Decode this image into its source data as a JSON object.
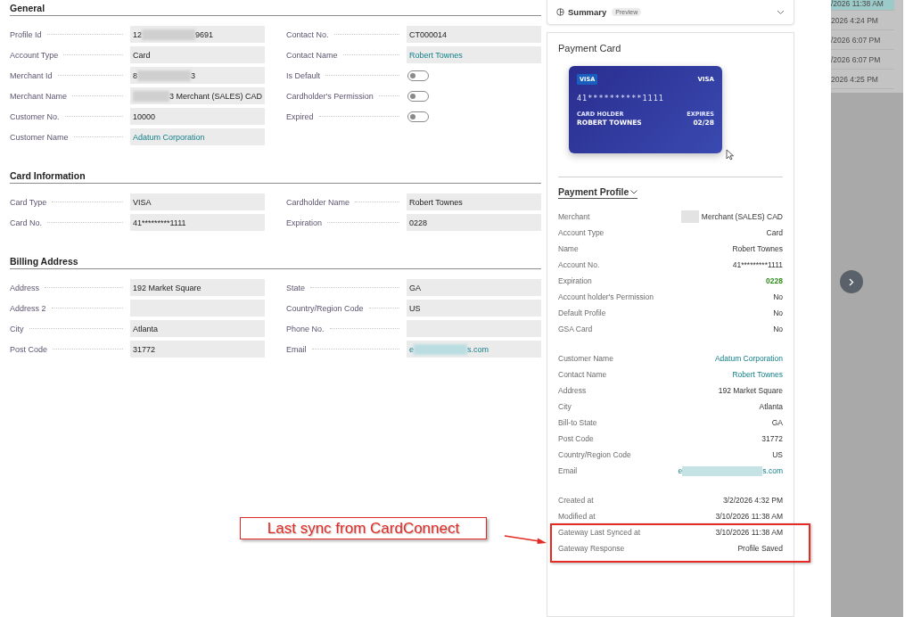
{
  "sections": [
    {
      "title": "General",
      "left": [
        {
          "label": "Profile Id",
          "kind": "text",
          "value": "12",
          "redacted": true,
          "value_end": "9691"
        },
        {
          "label": "Account Type",
          "kind": "text",
          "value": "Card"
        },
        {
          "label": "Merchant Id",
          "kind": "text",
          "value": "8",
          "redacted": true,
          "value_end": "3"
        },
        {
          "label": "Merchant Name",
          "kind": "text",
          "redacted": true,
          "value_end": "3 Merchant (SALES) CAD"
        },
        {
          "label": "Customer No.",
          "kind": "text",
          "value": "10000"
        },
        {
          "label": "Customer Name",
          "kind": "link",
          "value": "Adatum Corporation"
        }
      ],
      "right": [
        {
          "label": "Contact No.",
          "kind": "text",
          "value": "CT000014"
        },
        {
          "label": "Contact Name",
          "kind": "link",
          "value": "Robert Townes"
        },
        {
          "label": "Is Default",
          "kind": "toggle",
          "on": false
        },
        {
          "label": "Cardholder's Permission",
          "kind": "toggle",
          "on": false
        },
        {
          "label": "Expired",
          "kind": "toggle",
          "on": false
        }
      ]
    },
    {
      "title": "Card Information",
      "left": [
        {
          "label": "Card Type",
          "kind": "text",
          "value": "VISA"
        },
        {
          "label": "Card No.",
          "kind": "text",
          "value": "41*********1111"
        }
      ],
      "right": [
        {
          "label": "Cardholder Name",
          "kind": "text",
          "value": "Robert Townes"
        },
        {
          "label": "Expiration",
          "kind": "text",
          "value": "0228"
        }
      ]
    },
    {
      "title": "Billing Address",
      "left": [
        {
          "label": "Address",
          "kind": "text",
          "value": "192 Market Square"
        },
        {
          "label": "Address 2",
          "kind": "text"
        },
        {
          "label": "City",
          "kind": "text",
          "value": "Atlanta"
        },
        {
          "label": "Post Code",
          "kind": "text",
          "value": "31772"
        }
      ],
      "right": [
        {
          "label": "State",
          "kind": "text",
          "value": "GA"
        },
        {
          "label": "Country/Region Code",
          "kind": "text",
          "value": "US"
        },
        {
          "label": "Phone No.",
          "kind": "text"
        },
        {
          "label": "Email",
          "kind": "link",
          "value": "e",
          "redacted": true,
          "value_end": "s.com"
        }
      ]
    }
  ],
  "summary": {
    "title": "Summary",
    "badge": "Preview"
  },
  "payment_card": {
    "title": "Payment Card",
    "brand_badge": "VISA",
    "brand": "VISA",
    "number": "41**********1111",
    "holder_label": "CARD HOLDER",
    "holder": "ROBERT TOWNES",
    "expires_label": "EXPIRES",
    "expires": "02/28"
  },
  "payment_profile": {
    "title": "Payment Profile",
    "groups": [
      [
        {
          "label": "Merchant",
          "kind": "text",
          "redacted": true,
          "value_end": "Merchant (SALES) CAD"
        },
        {
          "label": "Account Type",
          "kind": "text",
          "value": "Card"
        },
        {
          "label": "Name",
          "kind": "text",
          "value": "Robert Townes"
        },
        {
          "label": "Account No.",
          "kind": "text",
          "value": "41*********1111"
        },
        {
          "label": "Expiration",
          "kind": "positive",
          "value": "0228"
        },
        {
          "label": "Account holder's Permission",
          "kind": "text",
          "value": "No"
        },
        {
          "label": "Default Profile",
          "kind": "text",
          "value": "No"
        },
        {
          "label": "GSA Card",
          "kind": "text",
          "value": "No"
        }
      ],
      [
        {
          "label": "Customer Name",
          "kind": "link",
          "value": "Adatum Corporation"
        },
        {
          "label": "Contact Name",
          "kind": "link",
          "value": "Robert Townes"
        },
        {
          "label": "Address",
          "kind": "text",
          "value": "192 Market Square"
        },
        {
          "label": "City",
          "kind": "text",
          "value": "Atlanta"
        },
        {
          "label": "Bill-to State",
          "kind": "text",
          "value": "GA"
        },
        {
          "label": "Post Code",
          "kind": "text",
          "value": "31772"
        },
        {
          "label": "Country/Region Code",
          "kind": "text",
          "value": "US"
        },
        {
          "label": "Email",
          "kind": "link",
          "value": "e",
          "redacted": true,
          "value_end": "s.com"
        }
      ],
      [
        {
          "label": "Created at",
          "kind": "text",
          "value": "3/2/2026 4:32 PM"
        },
        {
          "label": "Modified at",
          "kind": "text",
          "value": "3/10/2026 11:38 AM"
        },
        {
          "label": "Gateway Last Synced at",
          "kind": "text",
          "value": "3/10/2026 11:38 AM"
        },
        {
          "label": "Gateway Response",
          "kind": "text",
          "value": "Profile Saved"
        }
      ]
    ]
  },
  "side_list": {
    "items": [
      {
        "text": "/2026 11:38 AM",
        "selected": true
      },
      {
        "text": "2026 4:24 PM",
        "selected": false
      },
      {
        "text": "/2026 6:07 PM",
        "selected": false
      },
      {
        "text": "/2026 6:07 PM",
        "selected": false
      },
      {
        "text": "2026 4:25 PM",
        "selected": false
      }
    ]
  },
  "annotation": {
    "text": "Last sync from CardConnect"
  }
}
